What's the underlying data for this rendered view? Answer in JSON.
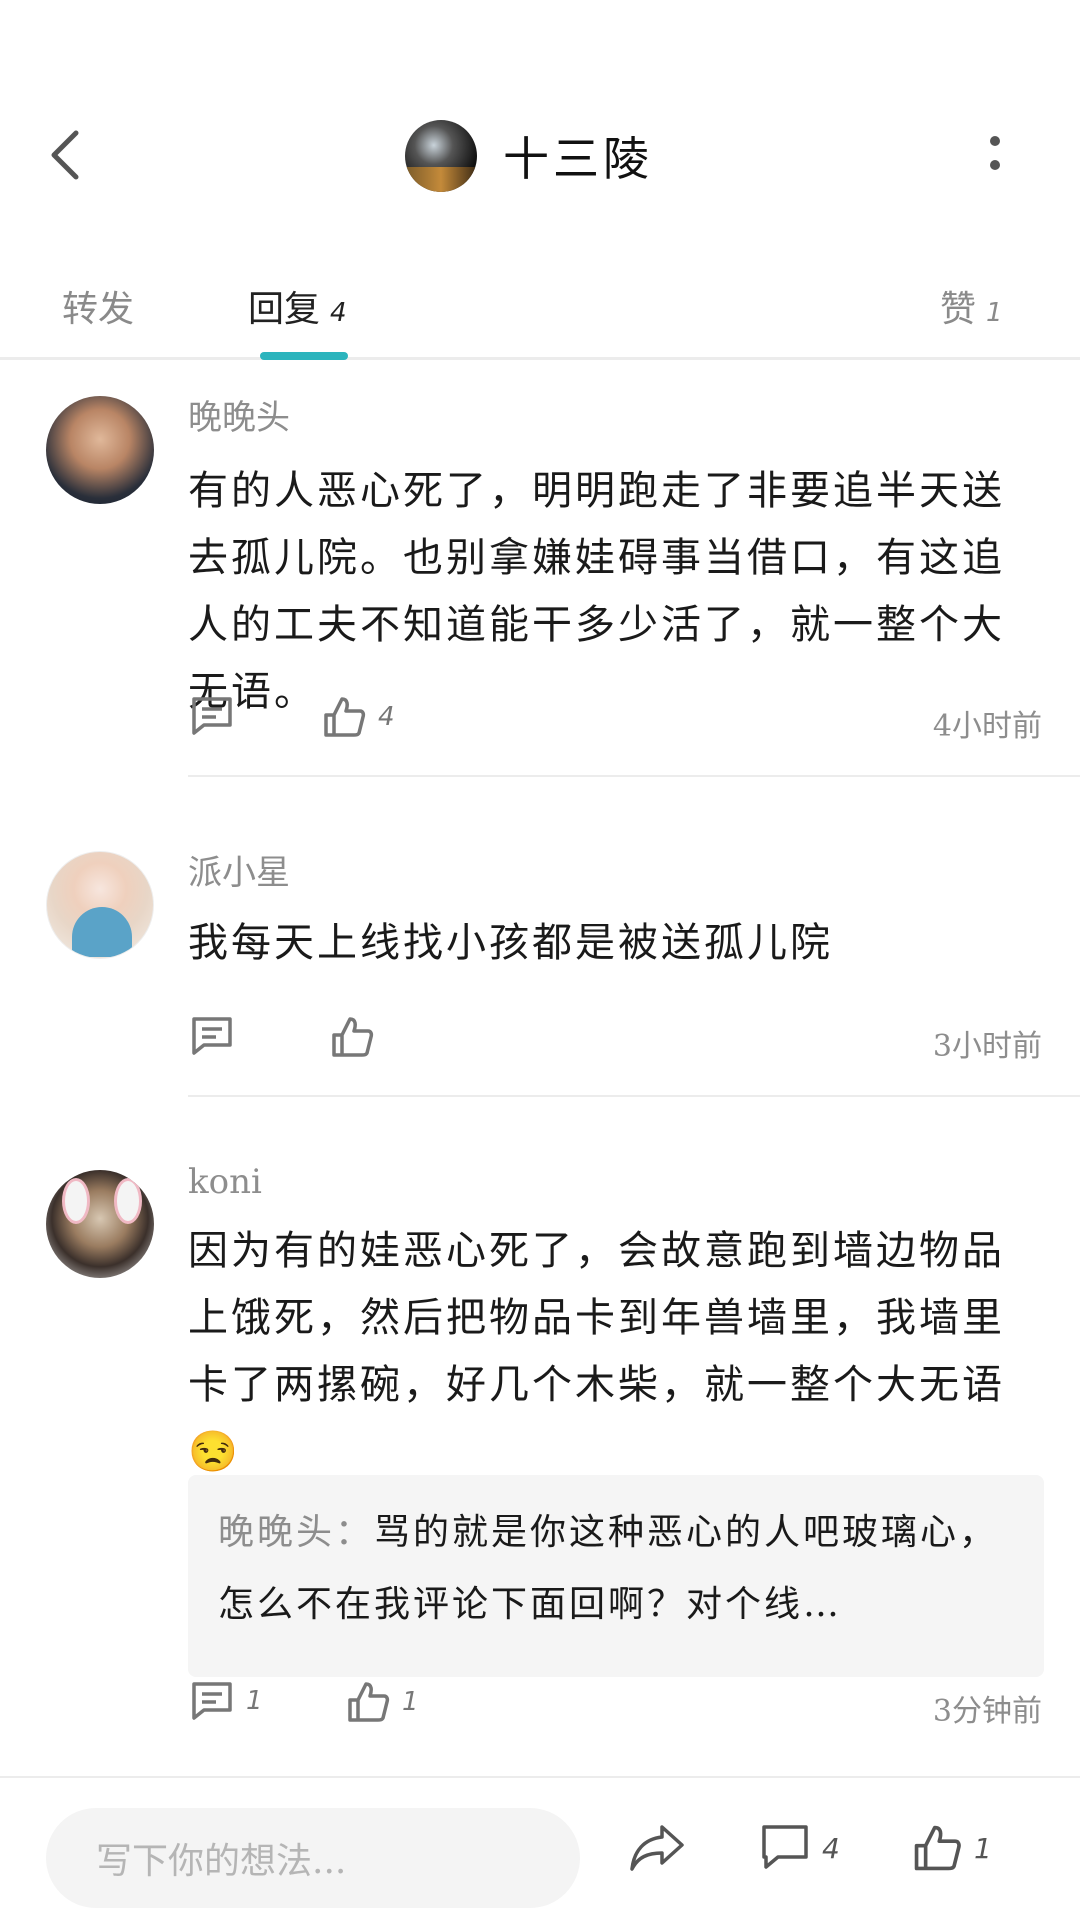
{
  "header": {
    "title": "十三陵",
    "back_icon": "chevron-left-icon",
    "more_icon": "more-vertical-icon"
  },
  "tabs": [
    {
      "label": "转发",
      "count": ""
    },
    {
      "label": "回复",
      "count": "4"
    },
    {
      "label": "赞",
      "count": "1"
    }
  ],
  "comments": [
    {
      "author": "晚晚头",
      "text": "有的人恶心死了，明明跑走了非要追半天送去孤儿院。也别拿嫌娃碍事当借口，有这追人的工夫不知道能干多少活了，就一整个大无语。",
      "reply_count": "",
      "like_count": "4",
      "time": "4小时前"
    },
    {
      "author": "派小星",
      "text": "我每天上线找小孩都是被送孤儿院",
      "reply_count": "",
      "like_count": "",
      "time": "3小时前"
    },
    {
      "author": "koni",
      "text": "因为有的娃恶心死了，会故意跑到墙边物品上饿死，然后把物品卡到年兽墙里，我墙里卡了两摞碗，好几个木柴，就一整个大无语😒",
      "reply_preview": {
        "author": "晚晚头：",
        "text": "骂的就是你这种恶心的人吧玻璃心，怎么不在我评论下面回啊？对个线…"
      },
      "reply_count": "1",
      "like_count": "1",
      "time": "3分钟前"
    }
  ],
  "bottom_bar": {
    "input_placeholder": "写下你的想法...",
    "comment_count": "4",
    "like_count": "1"
  },
  "colors": {
    "accent": "#2bb4bd",
    "muted_text": "#8d8d8d",
    "divider": "#ececec"
  }
}
